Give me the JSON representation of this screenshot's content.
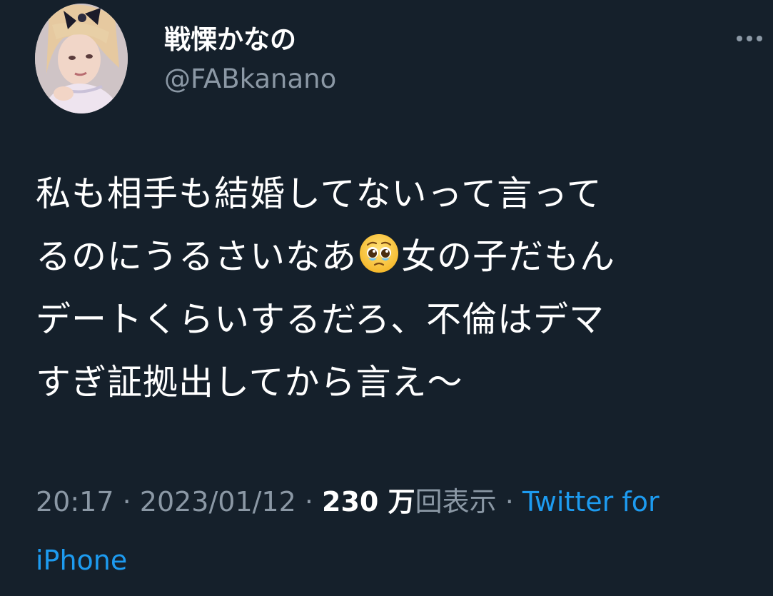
{
  "user": {
    "display_name": "戦慄かなの",
    "handle": "@FABkanano"
  },
  "tweet": {
    "lines": [
      "私も相手も結婚してないって言って",
      "るのにうるさいなあ",
      "女の子だもん",
      "デートくらいするだろ、不倫はデマ",
      "すぎ証拠出してから言え〜"
    ],
    "emoji": "pleading-face"
  },
  "meta": {
    "time": "20:17",
    "separator": " · ",
    "date": "2023/01/12",
    "views_count": "230 万",
    "views_label": "回表示",
    "source": "Twitter for iPhone"
  },
  "icons": {
    "more": "more-horizontal-icon",
    "emoji": "pleading-face-emoji-icon"
  },
  "colors": {
    "background": "#15202b",
    "text": "#ffffff",
    "muted": "#8b98a5",
    "link": "#1d9bf0"
  }
}
